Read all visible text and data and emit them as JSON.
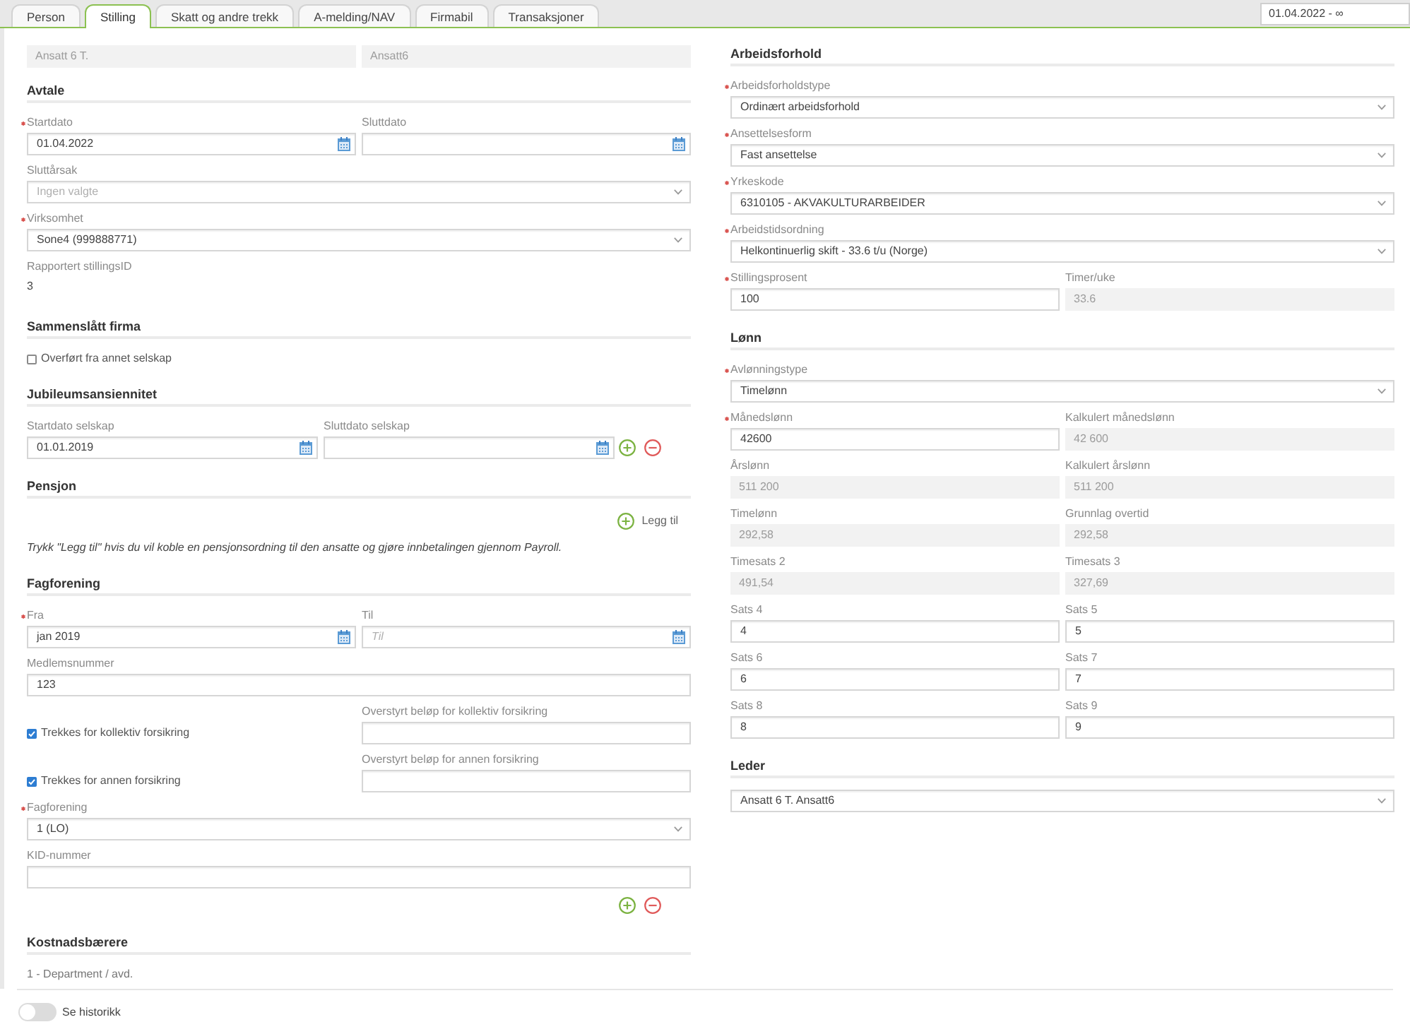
{
  "tabs": [
    {
      "label": "Person",
      "selected": false
    },
    {
      "label": "Stilling",
      "selected": true
    },
    {
      "label": "Skatt og andre trekk",
      "selected": false
    },
    {
      "label": "A-melding/NAV",
      "selected": false
    },
    {
      "label": "Firmabil",
      "selected": false
    },
    {
      "label": "Transaksjoner",
      "selected": false
    }
  ],
  "period_field": {
    "value": "01.04.2022 - ∞"
  },
  "left_column": {
    "rows": [
      {
        "cells": [
          {
            "kind": "readonly",
            "value": "Ansatt 6 T."
          },
          {
            "kind": "readonly",
            "value": "Ansatt6"
          }
        ]
      }
    ],
    "sections": [
      {
        "title": "Avtale",
        "rows": [
          {
            "cells": [
              {
                "kind": "date",
                "label": "Startdato",
                "required": true,
                "value": "01.04.2022"
              },
              {
                "kind": "date",
                "label": "Sluttdato",
                "required": false
              }
            ]
          },
          {
            "cells": [
              {
                "kind": "select",
                "label": "Sluttårsak",
                "required": false,
                "placeholder": "Ingen valgte"
              }
            ]
          },
          {
            "cells": [
              {
                "kind": "select",
                "label": "Virksomhet",
                "required": true,
                "value": "Sone4 (999888771)"
              }
            ]
          },
          {
            "cells": [
              {
                "kind": "text",
                "label": "Rapportert stillingsID",
                "value": "3"
              }
            ]
          }
        ]
      },
      {
        "title": "Sammenslått firma",
        "rows": [
          {
            "cells": [
              {
                "kind": "checkbox",
                "label": "Overført fra annet selskap",
                "checked": false
              }
            ]
          }
        ]
      },
      {
        "title": "Jubileumsansiennitet",
        "rows": [
          {
            "cells": [
              {
                "kind": "date",
                "label": "Startdato selskap",
                "required": false,
                "value": "01.01.2019"
              },
              {
                "kind": "date",
                "label": "Sluttdato selskap",
                "required": false
              }
            ],
            "actions": [
              {
                "kind": "add"
              },
              {
                "kind": "remove"
              }
            ]
          }
        ]
      },
      {
        "title": "Pensjon",
        "rows": [
          {
            "cells": [
              {
                "kind": "add_link",
                "label": "Legg til"
              }
            ]
          },
          {
            "cells": [
              {
                "kind": "note",
                "text": "Trykk \"Legg til\" hvis du vil koble en pensjonsordning til den ansatte og gjøre innbetalingen gjennom Payroll."
              }
            ]
          }
        ]
      },
      {
        "title": "Fagforening",
        "rows": [
          {
            "cells": [
              {
                "kind": "date",
                "label": "Fra",
                "required": true,
                "value": "jan 2019"
              },
              {
                "kind": "date",
                "label": "Til",
                "required": false,
                "placeholder": "Til"
              }
            ]
          },
          {
            "cells": [
              {
                "kind": "input",
                "label": "Medlemsnummer",
                "required": false,
                "value": "123"
              }
            ]
          },
          {
            "cells": [
              {
                "kind": "checkbox",
                "label": "Trekkes for kollektiv forsikring",
                "checked": true
              },
              {
                "kind": "input",
                "label": "Overstyrt beløp for kollektiv forsikring",
                "required": false
              }
            ]
          },
          {
            "cells": [
              {
                "kind": "checkbox",
                "label": "Trekkes for annen forsikring",
                "checked": true
              },
              {
                "kind": "input",
                "label": "Overstyrt beløp for annen forsikring",
                "required": false
              }
            ]
          },
          {
            "cells": [
              {
                "kind": "select",
                "label": "Fagforening",
                "required": true,
                "value": "1 (LO)"
              }
            ]
          },
          {
            "cells": [
              {
                "kind": "input",
                "label": "KID-nummer",
                "required": false
              }
            ]
          },
          {
            "actions": [
              {
                "kind": "add"
              },
              {
                "kind": "remove"
              }
            ]
          }
        ]
      },
      {
        "title": "Kostnadsbærere",
        "rows": [
          {
            "cells": [
              {
                "kind": "caption",
                "text": "1 - Department / avd."
              }
            ]
          }
        ]
      }
    ]
  },
  "right_column": {
    "sections": [
      {
        "title": "Arbeidsforhold",
        "rows": [
          {
            "cells": [
              {
                "kind": "select",
                "label": "Arbeidsforholdstype",
                "required": true,
                "value": "Ordinært arbeidsforhold"
              }
            ]
          },
          {
            "cells": [
              {
                "kind": "select",
                "label": "Ansettelsesform",
                "required": true,
                "value": "Fast ansettelse"
              }
            ]
          },
          {
            "cells": [
              {
                "kind": "select",
                "label": "Yrkeskode",
                "required": true,
                "value": "6310105 - AKVAKULTURARBEIDER"
              }
            ]
          },
          {
            "cells": [
              {
                "kind": "select",
                "label": "Arbeidstidsordning",
                "required": true,
                "value": "Helkontinuerlig skift - 33.6 t/u (Norge)"
              }
            ]
          },
          {
            "cells": [
              {
                "kind": "input",
                "label": "Stillingsprosent",
                "required": true,
                "value": "100"
              },
              {
                "kind": "readonly",
                "label": "Timer/uke",
                "required": false,
                "value": "33.6"
              }
            ]
          }
        ]
      },
      {
        "title": "Lønn",
        "rows": [
          {
            "cells": [
              {
                "kind": "select",
                "label": "Avlønningstype",
                "required": true,
                "value": "Timelønn"
              }
            ]
          },
          {
            "cells": [
              {
                "kind": "input",
                "label": "Månedslønn",
                "required": true,
                "value": "42600"
              },
              {
                "kind": "readonly",
                "label": "Kalkulert månedslønn",
                "required": false,
                "value": "42 600"
              }
            ]
          },
          {
            "cells": [
              {
                "kind": "readonly",
                "label": "Årslønn",
                "required": false,
                "value": "511 200"
              },
              {
                "kind": "readonly",
                "label": "Kalkulert årslønn",
                "required": false,
                "value": "511 200"
              }
            ]
          },
          {
            "cells": [
              {
                "kind": "readonly",
                "label": "Timelønn",
                "required": false,
                "value": "292,58"
              },
              {
                "kind": "readonly",
                "label": "Grunnlag overtid",
                "required": false,
                "value": "292,58"
              }
            ]
          },
          {
            "cells": [
              {
                "kind": "readonly",
                "label": "Timesats 2",
                "required": false,
                "value": "491,54"
              },
              {
                "kind": "readonly",
                "label": "Timesats 3",
                "required": false,
                "value": "327,69"
              }
            ]
          },
          {
            "cells": [
              {
                "kind": "input",
                "label": "Sats 4",
                "required": false,
                "value": "4"
              },
              {
                "kind": "input",
                "label": "Sats 5",
                "required": false,
                "value": "5"
              }
            ]
          },
          {
            "cells": [
              {
                "kind": "input",
                "label": "Sats 6",
                "required": false,
                "value": "6"
              },
              {
                "kind": "input",
                "label": "Sats 7",
                "required": false,
                "value": "7"
              }
            ]
          },
          {
            "cells": [
              {
                "kind": "input",
                "label": "Sats 8",
                "required": false,
                "value": "8"
              },
              {
                "kind": "input",
                "label": "Sats 9",
                "required": false,
                "value": "9"
              }
            ]
          }
        ]
      },
      {
        "title": "Leder",
        "rows": [
          {
            "cells": [
              {
                "kind": "select",
                "value": "Ansatt 6 T. Ansatt6"
              }
            ]
          }
        ]
      }
    ]
  },
  "history_toggle": {
    "label": "Se historikk",
    "on": false
  }
}
